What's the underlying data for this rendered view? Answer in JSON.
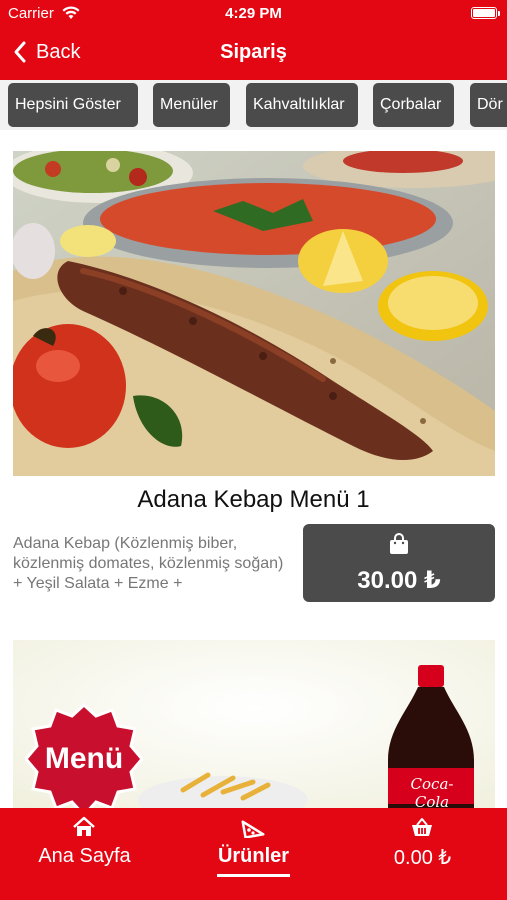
{
  "status_bar": {
    "carrier": "Carrier",
    "time": "4:29 PM"
  },
  "nav": {
    "back_label": "Back",
    "title": "Sipariş"
  },
  "categories": [
    {
      "label": "Hepsini Göster"
    },
    {
      "label": "Menüler"
    },
    {
      "label": "Kahvaltılıklar"
    },
    {
      "label": "Çorbalar"
    },
    {
      "label": "Dör"
    }
  ],
  "products": [
    {
      "name": "Adana Kebap Menü 1",
      "description": "Adana Kebap (Közlenmiş biber, közlenmiş domates, közlenmiş soğan) + Yeşil Salata + Ezme +",
      "price": "30.00 ₺"
    },
    {
      "badge": "Menü",
      "bottle_brand": "Coca-Cola"
    }
  ],
  "tab_bar": {
    "items": [
      {
        "label": "Ana Sayfa",
        "icon": "home-icon"
      },
      {
        "label": "Ürünler",
        "icon": "pizza-slice-icon",
        "active": true
      },
      {
        "label": "0.00 ₺",
        "icon": "basket-icon"
      }
    ]
  },
  "colors": {
    "brand_red": "#e30613",
    "button_gray": "#4b4b4b",
    "tab_strip_bg": "#f2f2f2"
  }
}
